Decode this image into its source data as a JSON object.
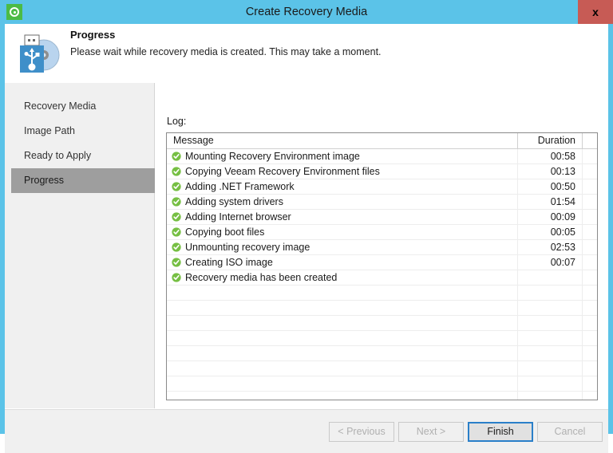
{
  "window": {
    "title": "Create Recovery Media",
    "app_icon": "veeam-logo-icon",
    "close_label": "x",
    "accent_color": "#5bc3e8",
    "close_color": "#c75b55"
  },
  "header": {
    "icon": "usb-disc-media-icon",
    "title": "Progress",
    "subtitle": "Please wait while recovery media is created. This may take a moment."
  },
  "sidebar": {
    "items": [
      {
        "label": "Recovery Media",
        "selected": false
      },
      {
        "label": "Image Path",
        "selected": false
      },
      {
        "label": "Ready to Apply",
        "selected": false
      },
      {
        "label": "Progress",
        "selected": true
      }
    ],
    "selected_color": "#9e9e9e"
  },
  "main": {
    "log_label": "Log:",
    "table": {
      "columns": [
        "Message",
        "Duration"
      ],
      "status_icon": "green-check-circle-icon",
      "status_color": "#76bf43",
      "rows": [
        {
          "message": "Mounting Recovery Environment image",
          "duration": "00:58"
        },
        {
          "message": "Copying Veeam Recovery Environment files",
          "duration": "00:13"
        },
        {
          "message": "Adding .NET Framework",
          "duration": "00:50"
        },
        {
          "message": "Adding system drivers",
          "duration": "01:54"
        },
        {
          "message": "Adding Internet browser",
          "duration": "00:09"
        },
        {
          "message": "Copying boot files",
          "duration": "00:05"
        },
        {
          "message": "Unmounting recovery image",
          "duration": "02:53"
        },
        {
          "message": "Creating ISO image",
          "duration": "00:07"
        },
        {
          "message": "Recovery media has been created",
          "duration": ""
        }
      ],
      "empty_row_count": 8
    }
  },
  "footer": {
    "buttons": [
      {
        "id": "btn-prev",
        "label": "< Previous",
        "enabled": false,
        "primary": false
      },
      {
        "id": "btn-next",
        "label": "Next >",
        "enabled": false,
        "primary": false
      },
      {
        "id": "btn-finish",
        "label": "Finish",
        "enabled": true,
        "primary": true
      },
      {
        "id": "btn-cancel",
        "label": "Cancel",
        "enabled": false,
        "primary": false
      }
    ]
  }
}
